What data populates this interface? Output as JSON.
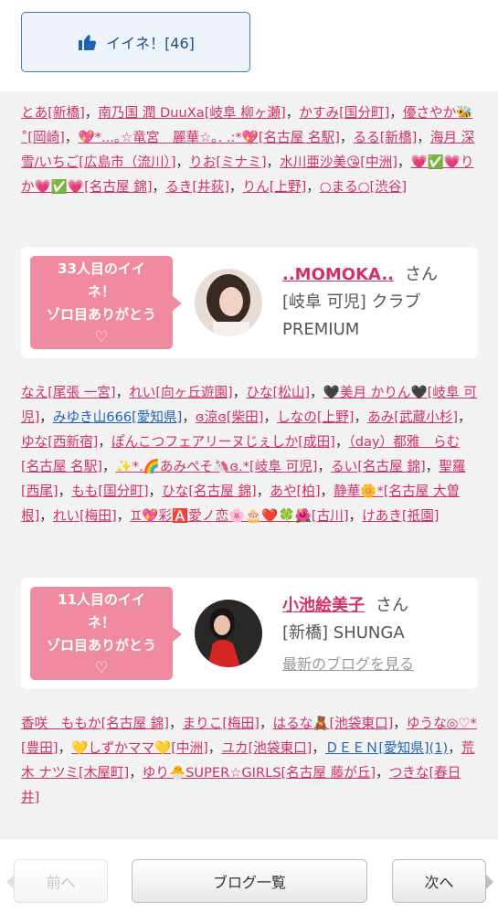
{
  "like": {
    "label": "イイネ！[46]",
    "icon": "thumbs-up-icon"
  },
  "names_top": [
    "とあ[新橋]",
    "南乃国 潤 DuuXa[岐阜 柳ヶ瀬]",
    "かすみ[国分町]",
    "優さやか🐝˚[岡崎]",
    "💖*...｡☆竜宮　麗華☆｡. .:*💖[名古屋 名駅]",
    "るる[新橋]",
    "海月 深雪/いちご[広島市（流川）]",
    "りお[ミナミ]",
    "水川亜沙美😘[中洲]",
    "💗✅💗りか💗✅💗[名古屋 錦]",
    "るき[井荻]",
    "りん[上野]",
    "○まる○[渋谷]"
  ],
  "card1": {
    "badge_line1": "33人目のイイ",
    "badge_line2": "ネ！",
    "badge_line3": "ゾロ目ありがとう",
    "badge_heart": "♡",
    "name": "..MOMOKA..",
    "san": "さん",
    "shop_line1": "[岐阜 可児] クラブ",
    "shop_line2": "PREMIUM"
  },
  "names_mid": [
    "なえ[尾張 一宮]",
    "れい[向ヶ丘遊園]",
    "ひな[松山]",
    "🖤美月 かりん🖤[岐阜 可児]",
    "みゆき山666[愛知県]",
    "ɞ涼ɞ[柴田]",
    "しなの[上野]",
    "あみ[武蔵小杉]",
    "ゆな[西新宿]",
    "ぽんこつフェアリーヌじぇしか[成田]",
    "（day）都雅　らむ[名古屋 名駅]",
    "✨*.🌈あみぺそ🦄ɞ.*[岐阜 可児]",
    "るい[名古屋 錦]",
    "聖羅[西尾]",
    "もも[国分町]",
    "ひな[名古屋 錦]",
    "あや[柏]",
    "静華🌼*[名古屋 大曽根]",
    "れい[梅田]",
    "♊💖彩🅰️愛ノ恋🌸🎂❤️🍀🌺[古川]",
    "けあき[祇園]"
  ],
  "card2": {
    "badge_line1": "11人目のイイ",
    "badge_line2": "ネ！",
    "badge_line3": "ゾロ目ありがとう",
    "badge_heart": "♡",
    "name": "小池絵美子",
    "san": "さん",
    "shop_line1": "[新橋] SHUNGA",
    "latest_blog": "最新のブログを見る"
  },
  "names_bottom": [
    "香咲　ももか[名古屋 錦]",
    "まりこ[梅田]",
    "はるな🧸[池袋東口]",
    "ゆうな◎♡*[豊田]",
    "💛しずかママ💛[中洲]",
    "ユカ[池袋東口]",
    "ＤＥＥＮ[愛知県](1)",
    "荒木 ナツミ[木屋町]",
    "ゆり🐣SUPER☆GIRLS[名古屋 藤が丘]",
    "つきな[春日井]"
  ],
  "nav": {
    "prev": "前へ",
    "list": "ブログ一覧",
    "next": "次へ"
  },
  "colors": {
    "link": "#d0316a",
    "blue_link": "#1e62b8",
    "badge": "#f08aa0",
    "gray_bg": "#f2f2f2"
  }
}
